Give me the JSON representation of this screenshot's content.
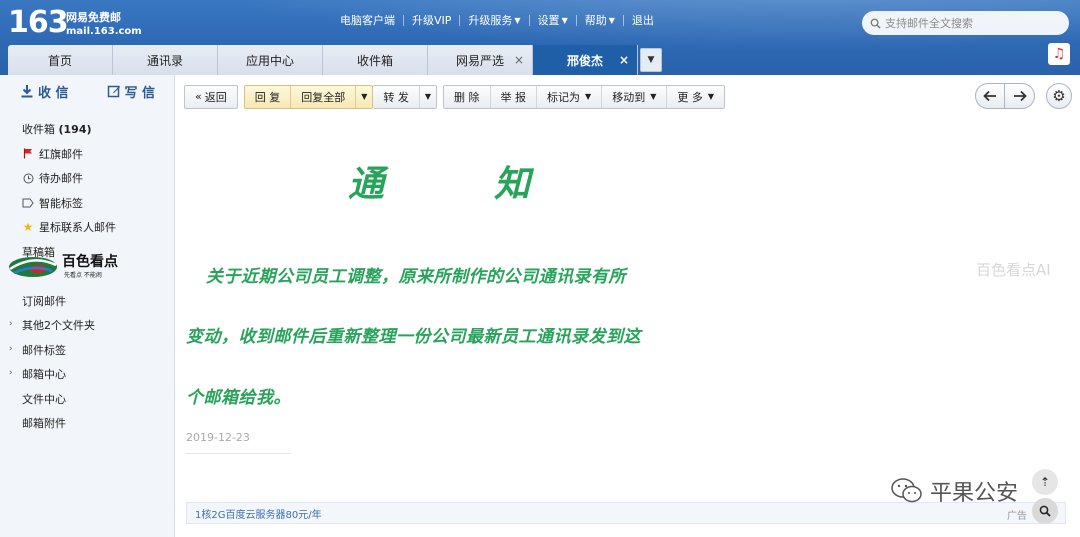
{
  "brand": {
    "number": "163",
    "name_cn": "网易免费邮",
    "url": "mail.163.com"
  },
  "topnav": [
    {
      "label": "电脑客户端",
      "dropdown": false
    },
    {
      "label": "升级VIP",
      "dropdown": false
    },
    {
      "label": "升级服务",
      "dropdown": true
    },
    {
      "label": "设置",
      "dropdown": true
    },
    {
      "label": "帮助",
      "dropdown": true
    },
    {
      "label": "退出",
      "dropdown": false
    }
  ],
  "search": {
    "placeholder": "支持邮件全文搜索"
  },
  "tabs": [
    {
      "label": "首页",
      "closable": false,
      "active": false
    },
    {
      "label": "通讯录",
      "closable": false,
      "active": false
    },
    {
      "label": "应用中心",
      "closable": false,
      "active": false
    },
    {
      "label": "收件箱",
      "closable": false,
      "active": false
    },
    {
      "label": "网易严选",
      "closable": true,
      "active": false
    },
    {
      "label": "邢俊杰",
      "closable": true,
      "active": true
    }
  ],
  "sidebar": {
    "receive_label": "收 信",
    "write_label": "写 信",
    "folders": [
      {
        "label": "收件箱",
        "count": "(194)",
        "icon": "none",
        "bold": true
      },
      {
        "label": "红旗邮件",
        "icon": "red-flag-icon"
      },
      {
        "label": "待办邮件",
        "icon": "clock-icon"
      },
      {
        "label": "智能标签",
        "icon": "tag-icon"
      },
      {
        "label": "星标联系人邮件",
        "icon": "star-icon"
      },
      {
        "label": "草稿箱",
        "icon": "none"
      },
      {
        "label": "",
        "icon": "none"
      },
      {
        "label": "订阅邮件",
        "icon": "none"
      },
      {
        "label": "其他2个文件夹",
        "icon": "expand-arrow"
      },
      {
        "label": "邮件标签",
        "icon": "expand-arrow"
      },
      {
        "label": "邮箱中心",
        "icon": "expand-arrow"
      },
      {
        "label": "文件中心",
        "icon": "none"
      },
      {
        "label": "邮箱附件",
        "icon": "none"
      }
    ],
    "watermark": {
      "name": "百色看点",
      "sub": "先看点 不能闹"
    }
  },
  "toolbar": {
    "back": "返回",
    "reply": "回 复",
    "reply_all": "回复全部",
    "forward": "转 发",
    "delete": "删 除",
    "report": "举 报",
    "mark_as": "标记为",
    "move_to": "移动到",
    "more": "更 多"
  },
  "email": {
    "title_char1": "通",
    "title_char2": "知",
    "line1": "关于近期公司员工调整，原来所制作的公司通讯录有所",
    "line2": "变动，收到邮件后重新整理一份公司最新员工通讯录发到这",
    "line3": "个邮箱给我。",
    "date": "2019-12-23"
  },
  "ad": {
    "text": "1核2G百度云服务器80元/年",
    "label": "广告"
  },
  "watermarks": {
    "right": "百色看点AI",
    "wechat": "平果公安"
  },
  "colors": {
    "header_blue": "#2d68b3",
    "active_tab": "#1f5fa8",
    "email_green": "#27a35a",
    "reply_yellow": "#f6e9b5"
  }
}
